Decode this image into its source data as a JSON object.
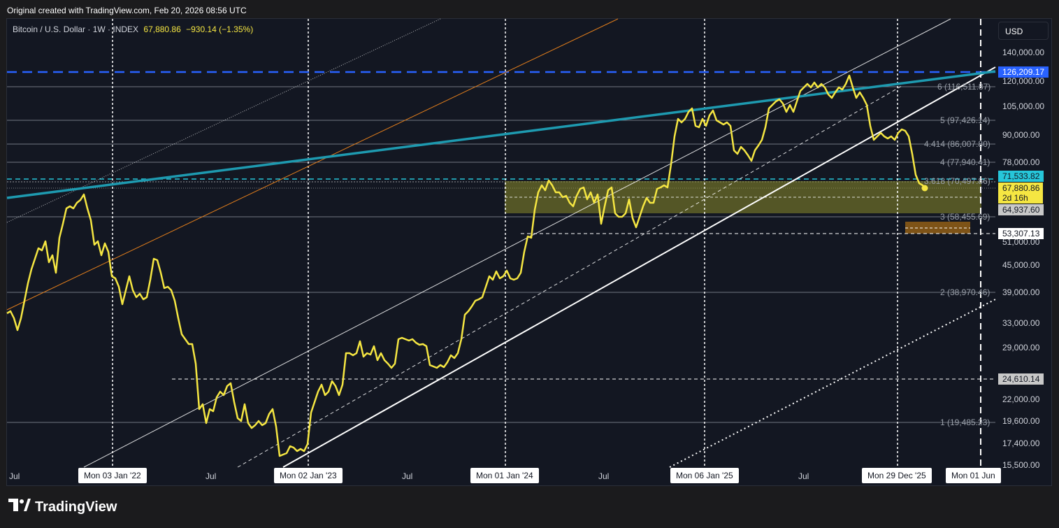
{
  "header": {
    "note": "Original created with TradingView.com, Feb 20, 2026 08:56 UTC"
  },
  "legend": {
    "symbol": "Bitcoin / U.S. Dollar · 1W · INDEX",
    "price": "67,880.86",
    "change": "−930.14 (−1.35%)"
  },
  "currency": "USD",
  "colors": {
    "price_line": "#f5e642",
    "trend_line": "#1e9ab0",
    "ath_line": "#2962ff",
    "zone": "#8a8a2a",
    "ob": "#8b5a16"
  },
  "y_axis_labels": [
    "140,000.00",
    "120,000.00",
    "105,000.00",
    "90,000.00",
    "78,000.00",
    "51,000.00",
    "45,000.00",
    "39,000.00",
    "33,000.00",
    "29,000.00",
    "22,000.00",
    "19,600.00",
    "17,400.00",
    "15,500.00"
  ],
  "fib_levels": [
    {
      "label": "6 (116,511.87)"
    },
    {
      "label": "5 (97,426.14)"
    },
    {
      "label": "4.414 (86,007.80)"
    },
    {
      "label": "4 (77,940.41)"
    },
    {
      "label": "3.618 (70,497.86)"
    },
    {
      "label": "3 (58,455.69)"
    },
    {
      "label": "2 (38,970.46)"
    },
    {
      "label": "1 (19,485.23)"
    }
  ],
  "price_tags": {
    "ath": "126,209.17",
    "cyan": "71,533.82",
    "last": "67,880.86",
    "countdown": "2d 16h",
    "gray1": "64,937.60",
    "white1": "53,307.13",
    "gray2": "24,610.14"
  },
  "x_axis": {
    "plain": [
      "Jul",
      "Jul",
      "Jul",
      "Jul",
      "Jul"
    ],
    "tags": [
      "Mon 03 Jan '22",
      "Mon 02 Jan '23",
      "Mon 01 Jan '24",
      "Mon 06 Jan '25",
      "Mon 29 Dec '25",
      "Mon 01 Jun"
    ]
  },
  "footer": {
    "brand": "TradingView"
  }
}
